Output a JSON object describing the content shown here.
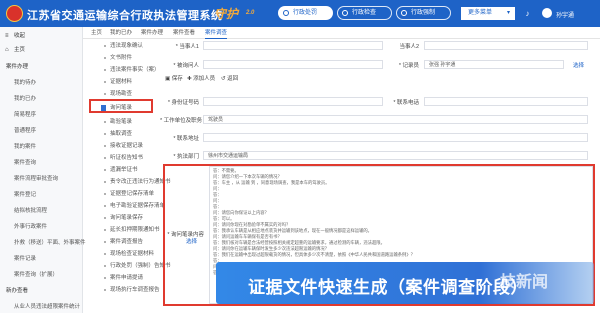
{
  "header": {
    "title": "江苏省交通运输综合行政执法管理系统",
    "brand": "守护",
    "brand_version": "2.0",
    "nav": [
      {
        "label": "行政处罚",
        "icon": "gavel-icon",
        "active": true
      },
      {
        "label": "行政检查",
        "icon": "search-icon",
        "active": false
      },
      {
        "label": "行政强制",
        "icon": "lock-icon",
        "active": false
      }
    ],
    "more_label": "更多菜单",
    "user_name": "孙宇通"
  },
  "sidebar": {
    "items": [
      {
        "label": "收起",
        "icon": "menu-icon",
        "kind": "top"
      },
      {
        "label": "主页",
        "icon": "home-icon",
        "kind": "top"
      },
      {
        "label": "案件办理",
        "kind": "group"
      },
      {
        "label": "我的待办"
      },
      {
        "label": "我的已办"
      },
      {
        "label": "简易程序"
      },
      {
        "label": "普通程序"
      },
      {
        "label": "我的案件"
      },
      {
        "label": "案件查询"
      },
      {
        "label": "案件流程审批查询"
      },
      {
        "label": "案件登记"
      },
      {
        "label": "结拟核批流程"
      },
      {
        "label": "外事行政案件"
      },
      {
        "label": "扑救（移送）平面、外事案件"
      },
      {
        "label": "案件记录"
      },
      {
        "label": "案件查询（扩展）"
      },
      {
        "label": "新办查看",
        "kind": "group"
      },
      {
        "label": "从业人员违法超限案件统计"
      }
    ]
  },
  "tabs": [
    "主页",
    "我的已办",
    "案件办理",
    "案件查看",
    "案件调查"
  ],
  "menu2": {
    "items": [
      "违法现象确认",
      "文书附件",
      "违法案件事实（案）",
      "证据材料",
      "现场勘查",
      "询问笔录",
      "勘验笔录",
      "抽取调查",
      "接收证据记录",
      "听证权告知书",
      "遗漏举证书",
      "责令改正违法行为通知书",
      "证据登记保存清单",
      "电子勘验证据保存清单",
      "询问笔录保存",
      "延长扣押期限通知书",
      "案件调查报告",
      "现场检查证据材料",
      "行政处罚（强制）告知书",
      "案件申请提请",
      "现场执行车调查报告"
    ],
    "highlighted_index": 5
  },
  "toolbar": {
    "save": "保存",
    "add_person": "添加人员",
    "return": "返回"
  },
  "form": {
    "party1_label": "* 当事人1",
    "party1_value": "",
    "party2_label": "当事人2",
    "party2_value": "",
    "inquirer_label": "* 被询问人",
    "inquirer_value": "",
    "recorder_label": "* 记录员",
    "recorder_value": "张强 孙宇通",
    "select_link": "选择",
    "id_label": "* 身份证号码",
    "id_value": "",
    "phone_label": "* 联系电话",
    "phone_value": "",
    "workplace_label": "* 工作单位及职务",
    "workplace_value": "驾驶员",
    "address_label": "* 联系地址",
    "address_value": "",
    "dept_label": "* 执法部门",
    "dept_value": "徐州市交通运输局",
    "notes_label": "* 询问笔录内容",
    "notes_select": "选择"
  },
  "notes": [
    "答：不需要。",
    "问：请您介绍一下本次车辆的情况？",
    "答：车主 ，从 运输 到 ，同意现场调查，我是本车的驾驶员。",
    "问：",
    "答：",
    "问：",
    "答：",
    "问：请您向你保证以上内容？",
    "答：可以。",
    "问：请问你现在对勘验单不属实的对吗？",
    "答：我承认车辆是从相应地点装货并运输到该地点，现在一般情况都是这样运输的。",
    "问：请问运输车车辆保有是否有书？",
    "答：我们核对车辆是合法经营按照相关规定超重的运输要求，通过检测的车辆，违法超限。",
    "问：请问你在运输车辆保时发生多少次违法超限运输的情况？",
    "答：我们在运输中出现过超限载货的情况，但具体多少次不清楚，依照《中华人民共和国道路运输条例》？",
    "答：",
    "问：",
    "答："
  ],
  "banner": {
    "text": "证据文件快速生成（案件调查阶段）",
    "watermark": "技新闻"
  },
  "colors": {
    "header_bg": "#1e63c7",
    "highlight": "#e03a2f",
    "brand": "#f2a93b"
  }
}
